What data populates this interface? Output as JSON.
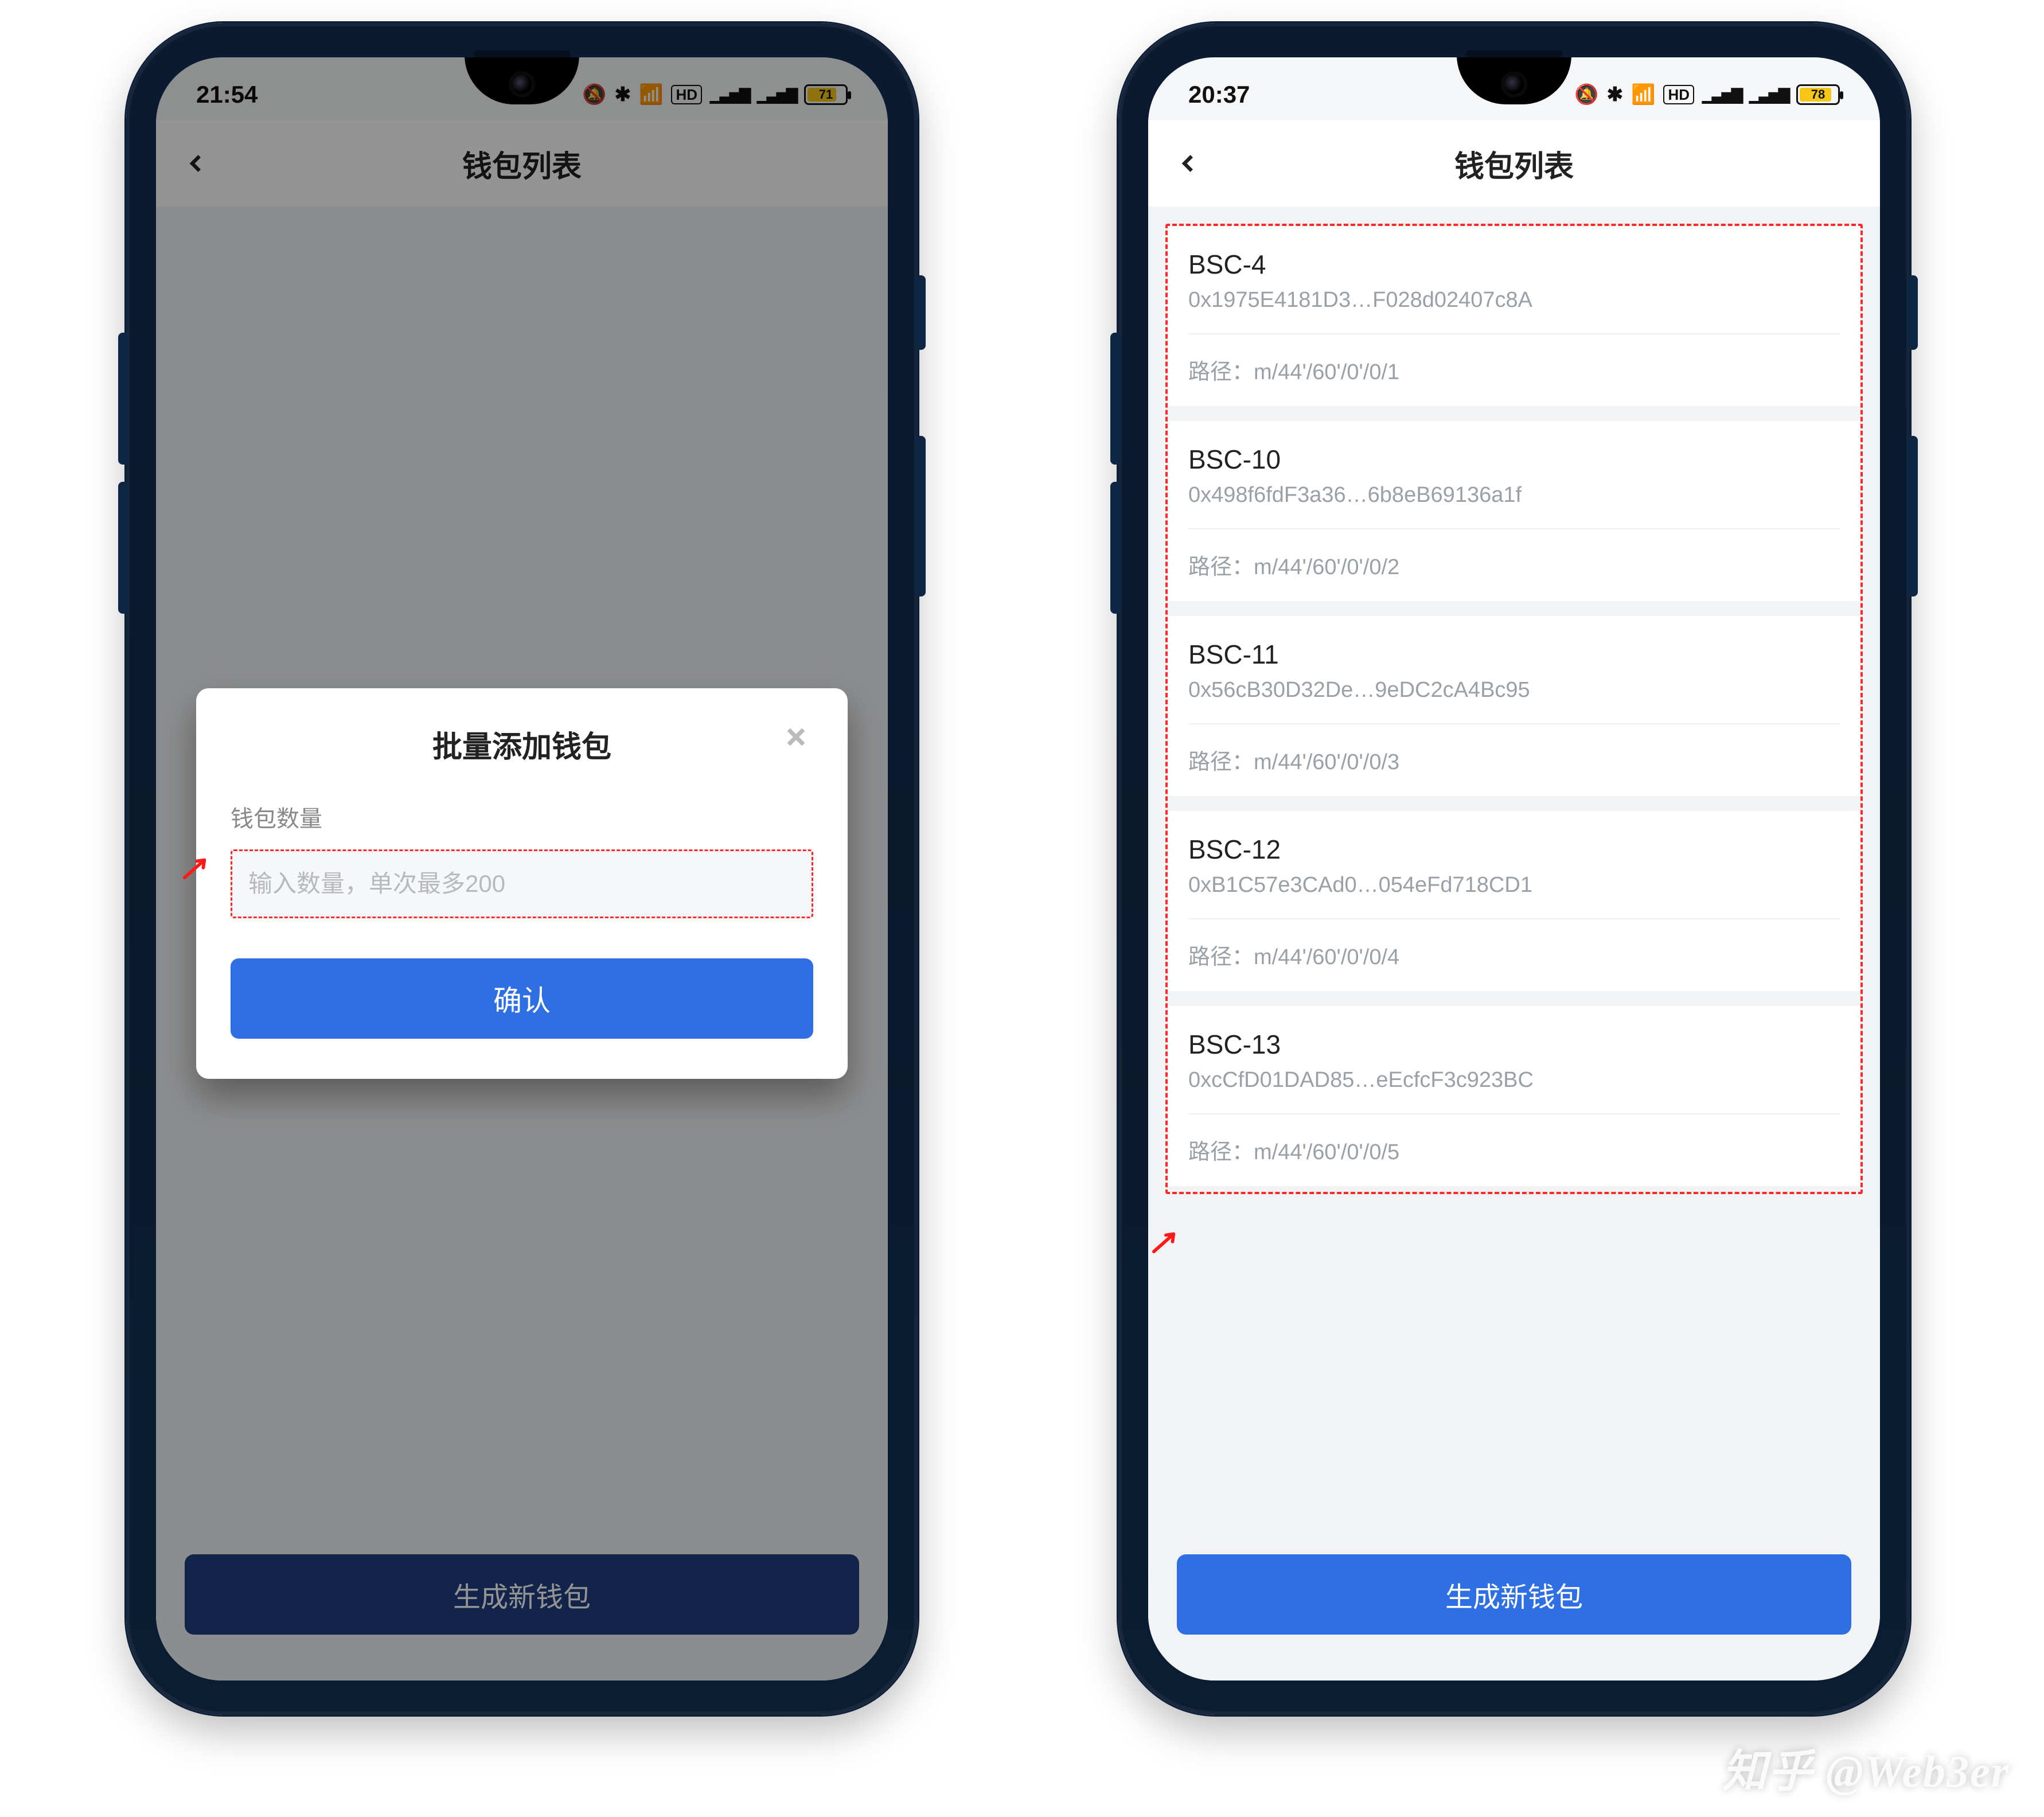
{
  "watermark": "知乎 @Web3er",
  "colors": {
    "accent": "#2f6fe4",
    "accent_dark": "#1f3f80",
    "danger_dash": "#ff2a2a"
  },
  "left": {
    "status": {
      "time": "21:54",
      "battery": "71",
      "battery_fill": "71%"
    },
    "header": {
      "title": "钱包列表"
    },
    "modal": {
      "title": "批量添加钱包",
      "label": "钱包数量",
      "placeholder": "输入数量，单次最多200",
      "confirm": "确认"
    },
    "footer": "生成新钱包"
  },
  "right": {
    "status": {
      "time": "20:37",
      "battery": "78",
      "battery_fill": "78%"
    },
    "header": {
      "title": "钱包列表"
    },
    "path_label": "路径：",
    "wallets": [
      {
        "name": "BSC-4",
        "addr": "0x1975E4181D3…F028d02407c8A",
        "path": "m/44'/60'/0'/0/1"
      },
      {
        "name": "BSC-10",
        "addr": "0x498f6fdF3a36…6b8eB69136a1f",
        "path": "m/44'/60'/0'/0/2"
      },
      {
        "name": "BSC-11",
        "addr": "0x56cB30D32De…9eDC2cA4Bc95",
        "path": "m/44'/60'/0'/0/3"
      },
      {
        "name": "BSC-12",
        "addr": "0xB1C57e3CAd0…054eFd718CD1",
        "path": "m/44'/60'/0'/0/4"
      },
      {
        "name": "BSC-13",
        "addr": "0xcCfD01DAD85…eEcfcF3c923BC",
        "path": "m/44'/60'/0'/0/5"
      }
    ],
    "footer": "生成新钱包"
  }
}
